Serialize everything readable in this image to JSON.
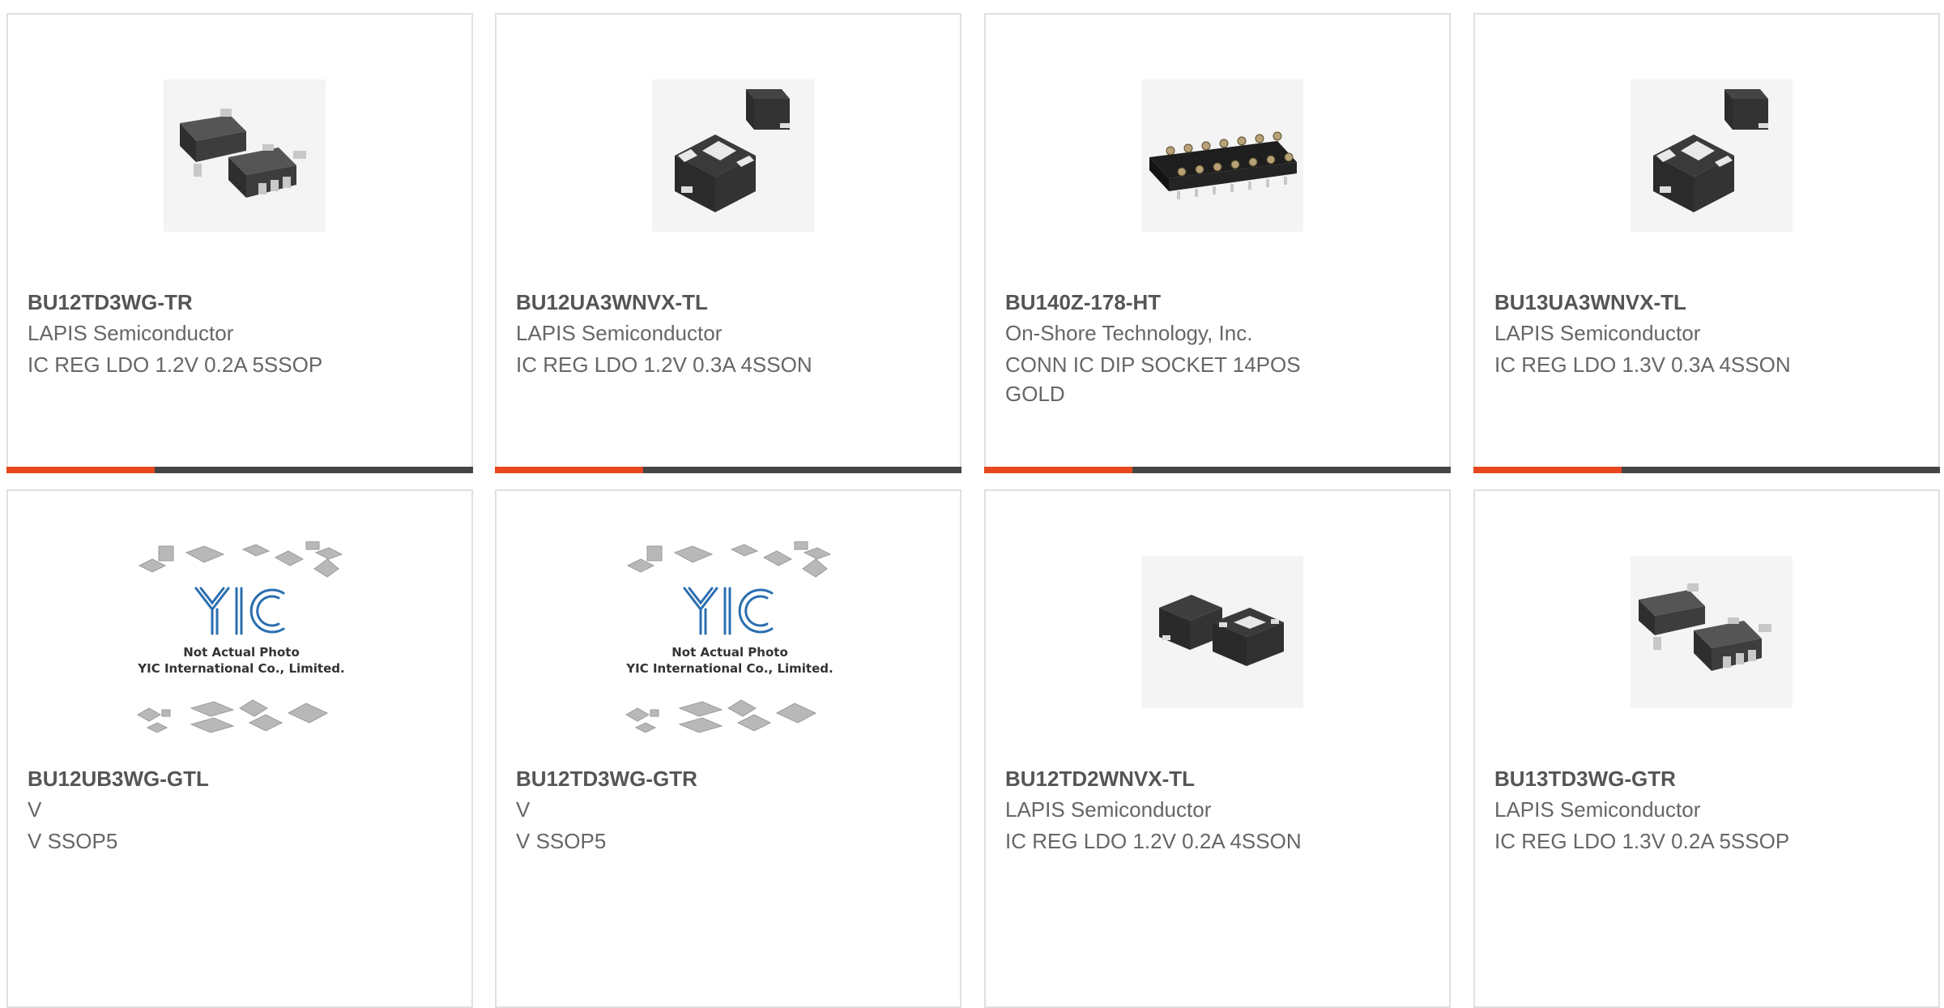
{
  "colors": {
    "accent": "#e8461e",
    "bar": "#444444",
    "border": "#e0e0e0",
    "text": "#666666"
  },
  "products": [
    {
      "part": "BU12TD3WG-TR",
      "manufacturer": "LAPIS Semiconductor",
      "description": "IC REG LDO 1.2V 0.2A 5SSOP",
      "image_icon": "sot23-5-package-icon"
    },
    {
      "part": "BU12UA3WNVX-TL",
      "manufacturer": "LAPIS Semiconductor",
      "description": "IC REG LDO 1.2V 0.3A 4SSON",
      "image_icon": "sson-package-icon"
    },
    {
      "part": "BU140Z-178-HT",
      "manufacturer": "On-Shore Technology, Inc.",
      "description": "CONN IC DIP SOCKET 14POS GOLD",
      "image_icon": "dip-socket-icon"
    },
    {
      "part": "BU13UA3WNVX-TL",
      "manufacturer": "LAPIS Semiconductor",
      "description": "IC REG LDO 1.3V 0.3A 4SSON",
      "image_icon": "sson-package-icon"
    },
    {
      "part": "BU12UB3WG-GTL",
      "manufacturer": "V",
      "description": "V SSOP5",
      "image_icon": "placeholder-photo-icon",
      "placeholder_lines": [
        "Not Actual Photo",
        "YIC International Co., Limited."
      ]
    },
    {
      "part": "BU12TD3WG-GTR",
      "manufacturer": "V",
      "description": "V SSOP5",
      "image_icon": "placeholder-photo-icon",
      "placeholder_lines": [
        "Not Actual Photo",
        "YIC International Co., Limited."
      ]
    },
    {
      "part": "BU12TD2WNVX-TL",
      "manufacturer": "LAPIS Semiconductor",
      "description": "IC REG LDO 1.2V 0.2A 4SSON",
      "image_icon": "sson-package-icon"
    },
    {
      "part": "BU13TD3WG-GTR",
      "manufacturer": "LAPIS Semiconductor",
      "description": "IC REG LDO 1.3V 0.2A 5SSOP",
      "image_icon": "sot23-5-package-icon"
    }
  ]
}
